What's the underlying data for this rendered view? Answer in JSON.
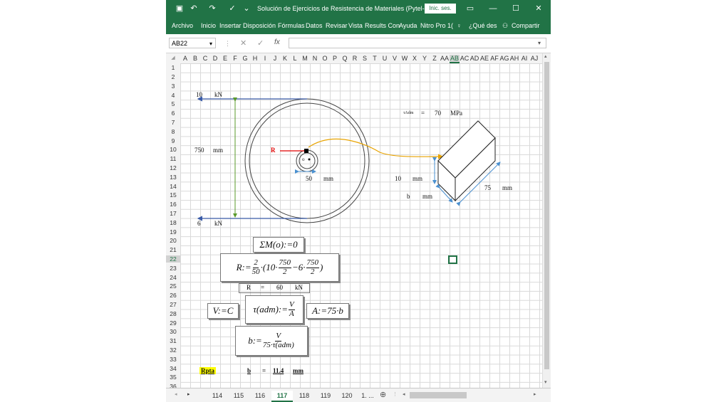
{
  "window": {
    "title": "Solución de Ejercicios de Resistencia de Materiales (Pytel-Si...",
    "signin": "Inic. ses.",
    "undo_icon": "undo-icon",
    "redo_icon": "redo-icon",
    "save_icon": "save-icon",
    "accent": "#217346"
  },
  "ribbon": {
    "tabs": [
      "Archivo",
      "Inicio",
      "Insertar",
      "Disposición",
      "Fórmulas",
      "Datos",
      "Revisar",
      "Vista",
      "Results Con",
      "Ayuda",
      "Nitro Pro 1("
    ],
    "tell_me": "¿Qué des",
    "share": "Compartir"
  },
  "formula_bar": {
    "name_box": "AB22",
    "fx": "fx",
    "value": ""
  },
  "columns": [
    "A",
    "B",
    "C",
    "D",
    "E",
    "F",
    "G",
    "H",
    "I",
    "J",
    "K",
    "L",
    "M",
    "N",
    "O",
    "P",
    "Q",
    "R",
    "S",
    "T",
    "U",
    "V",
    "W",
    "X",
    "Y",
    "Z",
    "AA",
    "AB",
    "AC",
    "AD",
    "AE",
    "AF",
    "AG",
    "AH",
    "AI",
    "AJ"
  ],
  "rows": [
    "1",
    "2",
    "3",
    "4",
    "5",
    "6",
    "7",
    "8",
    "9",
    "10",
    "11",
    "12",
    "13",
    "14",
    "15",
    "16",
    "17",
    "18",
    "19",
    "20",
    "21",
    "22",
    "23",
    "24",
    "25",
    "26",
    "27",
    "28",
    "29",
    "30",
    "31",
    "32",
    "33",
    "34",
    "35",
    "36"
  ],
  "sheet_tabs": [
    "114",
    "115",
    "116",
    "117",
    "118",
    "119",
    "120",
    "1. ..."
  ],
  "active_tab": "117",
  "diagram": {
    "force_top_value": "10",
    "force_top_unit": "kN",
    "force_bottom_value": "6",
    "force_bottom_unit": "kN",
    "diameter_value": "750",
    "diameter_unit": "mm",
    "hub_value": "50",
    "hub_unit": "mm",
    "r_label": "R",
    "o_label": "o",
    "tau_label": "τAdm",
    "tau_eq": "=",
    "tau_value": "70",
    "tau_unit": "MPa",
    "key_h_value": "10",
    "key_h_unit": "mm",
    "key_b_label": "b",
    "key_b_unit": "mm",
    "key_len_value": "75",
    "key_len_unit": "mm"
  },
  "math": {
    "sum_moment": "ΣM(o):=0",
    "r_lhs": "R:=",
    "r_frac1_num": "2",
    "r_frac1_den": "50",
    "r_dot": "·(10·",
    "r_frac2_num": "750",
    "r_frac2_den": "2",
    "r_mid": "−6·",
    "r_frac3_num": "750",
    "r_frac3_den": "2",
    "r_close": ")",
    "r_result_label": "R",
    "r_result_eq": "=",
    "r_result_value": "60",
    "r_result_unit": "kN",
    "v_eq": "V:=C",
    "tau_lhs": "τ(adm):=",
    "tau_num": "V",
    "tau_den": "A",
    "a_eq": "A:=75·b",
    "b_lhs": "b:=",
    "b_num": "V",
    "b_den": "75·τ(adm)"
  },
  "answer": {
    "label": "Rpta",
    "var": "b",
    "eq": "=",
    "value": "11.4",
    "unit": "mm"
  }
}
